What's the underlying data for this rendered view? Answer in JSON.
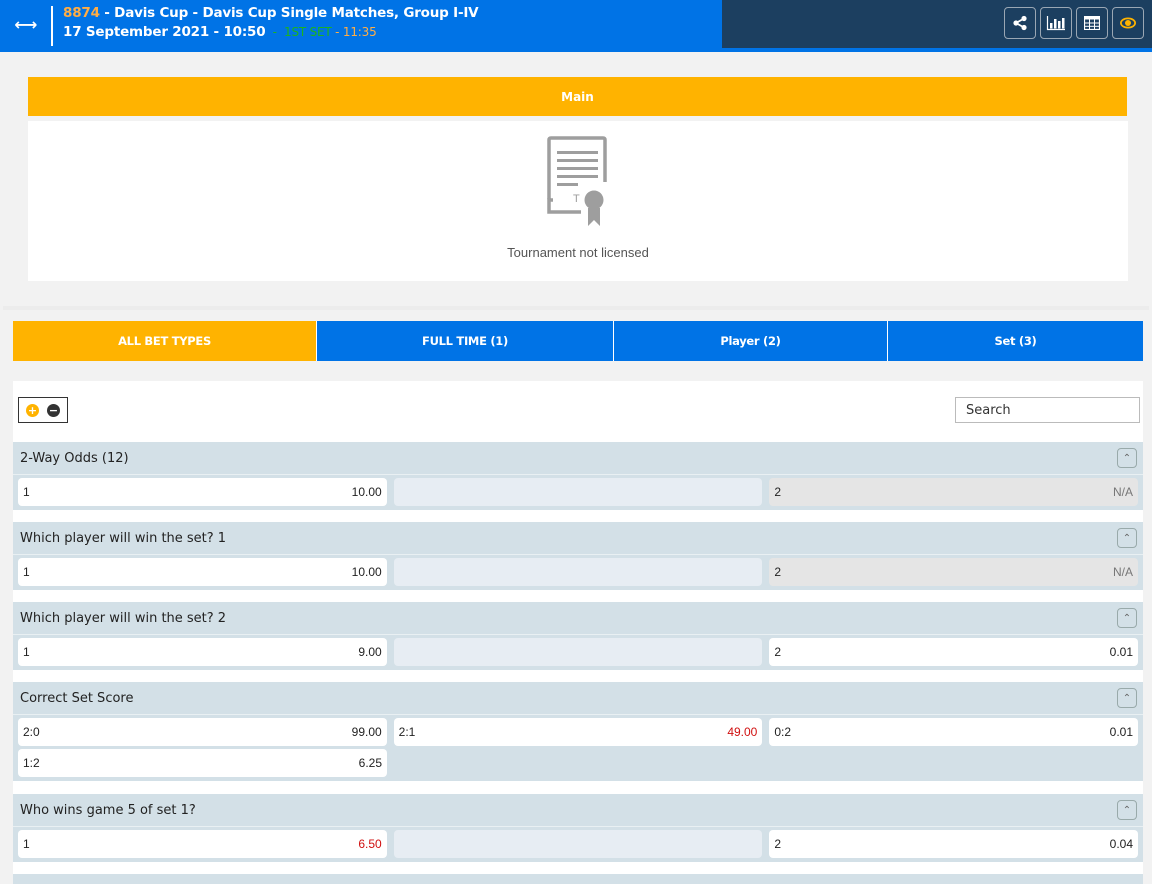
{
  "header": {
    "event_id": "8874",
    "event_title": " - Davis Cup - Davis Cup Single Matches, Group I-IV",
    "date_time": "17 September 2021 - 10:50",
    "sep1": "  -  ",
    "status": "1ST SET",
    "sep2": " - ",
    "clock": "11:35",
    "icons": [
      "share-icon",
      "statistics-icon",
      "table-icon",
      "eye-icon"
    ]
  },
  "main_panel": {
    "header_label": "Main",
    "message": "Tournament not licensed"
  },
  "tabs": [
    {
      "label": "ALL BET TYPES",
      "active": true
    },
    {
      "label": "FULL TIME (1)",
      "active": false
    },
    {
      "label": "Player (2)",
      "active": false
    },
    {
      "label": "Set (3)",
      "active": false
    }
  ],
  "toolbar": {
    "expand_all": "+",
    "collapse_all": "−",
    "search_placeholder": "Search"
  },
  "colors": {
    "brand_blue": "#0073e6",
    "accent_orange": "#ffb300",
    "header_dark": "#1c3f60",
    "odd_drop_red": "#d01010",
    "status_green": "#1db31d"
  },
  "markets": [
    {
      "title": "2-Way Odds (12)",
      "rows": [
        [
          {
            "label": "1",
            "odd": "10.00"
          },
          {
            "empty": true
          },
          {
            "label": "2",
            "odd": "N/A",
            "na": true
          }
        ]
      ]
    },
    {
      "title": "Which player will win the set? 1",
      "rows": [
        [
          {
            "label": "1",
            "odd": "10.00"
          },
          {
            "empty": true
          },
          {
            "label": "2",
            "odd": "N/A",
            "na": true
          }
        ]
      ]
    },
    {
      "title": "Which player will win the set? 2",
      "rows": [
        [
          {
            "label": "1",
            "odd": "9.00"
          },
          {
            "empty": true
          },
          {
            "label": "2",
            "odd": "0.01"
          }
        ]
      ]
    },
    {
      "title": "Correct Set Score",
      "rows": [
        [
          {
            "label": "2:0",
            "odd": "99.00"
          },
          {
            "label": "2:1",
            "odd": "49.00",
            "red": true
          },
          {
            "label": "0:2",
            "odd": "0.01"
          }
        ],
        [
          {
            "label": "1:2",
            "odd": "6.25"
          }
        ]
      ]
    },
    {
      "title": "Who wins game 5 of set 1?",
      "rows": [
        [
          {
            "label": "1",
            "odd": "6.50",
            "red": true
          },
          {
            "empty": true
          },
          {
            "label": "2",
            "odd": "0.04"
          }
        ]
      ]
    }
  ]
}
